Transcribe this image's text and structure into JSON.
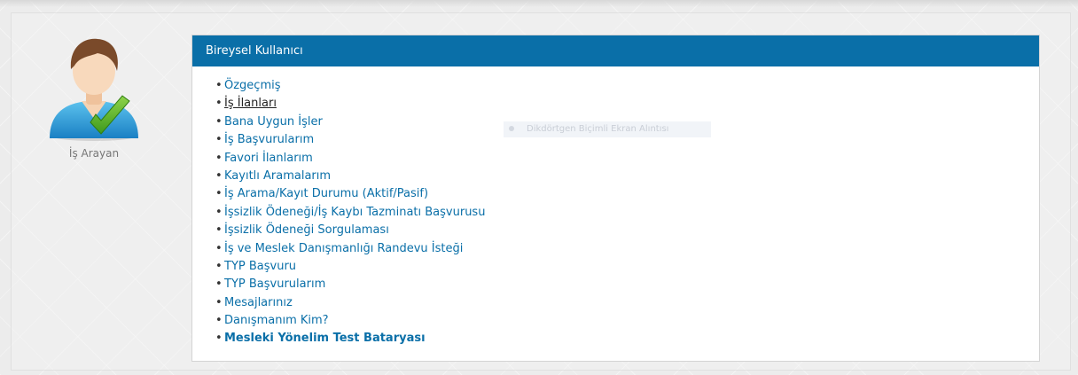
{
  "profile": {
    "avatar_icon": "job-seeker-avatar-checkmark-icon",
    "role_label": "İş Arayan"
  },
  "panel": {
    "title": "Bireysel Kullanıcı",
    "header_color": "#0a6fa8",
    "link_color": "#0a6fa8",
    "items": [
      {
        "label": "Özgeçmiş"
      },
      {
        "label": "İş İlanları",
        "state": "current"
      },
      {
        "label": "Bana Uygun İşler"
      },
      {
        "label": "İş Başvurularım"
      },
      {
        "label": "Favori İlanlarım"
      },
      {
        "label": "Kayıtlı Aramalarım"
      },
      {
        "label": "İş Arama/Kayıt Durumu (Aktif/Pasif)"
      },
      {
        "label": "İşsizlik Ödeneği/İş Kaybı Tazminatı Başvurusu"
      },
      {
        "label": "İşsizlik Ödeneği Sorgulaması"
      },
      {
        "label": "İş ve Meslek Danışmanlığı Randevu İsteği"
      },
      {
        "label": "TYP Başvuru"
      },
      {
        "label": "TYP Başvurularım"
      },
      {
        "label": "Mesajlarınız"
      },
      {
        "label": "Danışmanım Kim?"
      },
      {
        "label": "Mesleki Yönelim Test Bataryası",
        "style": "bold"
      }
    ]
  },
  "overlay": {
    "text": "Dikdörtgen Biçimli Ekran Alıntısı"
  }
}
